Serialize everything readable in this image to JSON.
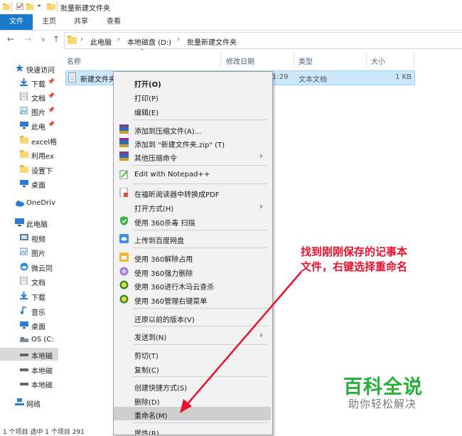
{
  "window": {
    "title": "批量新建文件夹"
  },
  "ribbon": {
    "tabs": [
      "文件",
      "主页",
      "共享",
      "查看"
    ]
  },
  "address": {
    "crumbs": [
      "此电脑",
      "本地磁盘 (D:)",
      "批量新建文件夹"
    ]
  },
  "columns": {
    "name": "名称",
    "modified": "修改日期",
    "type": "类型",
    "size": "大小"
  },
  "file": {
    "name": "新建文件夹",
    "time": "1:29",
    "type": "文本文档",
    "size": "1 KB"
  },
  "nav": {
    "items": [
      {
        "label": "快速访问",
        "icon": "star-icon"
      },
      {
        "label": "下载",
        "icon": "download-icon"
      },
      {
        "label": "文档",
        "icon": "document-icon"
      },
      {
        "label": "图片",
        "icon": "picture-icon"
      },
      {
        "label": "此电",
        "icon": "desktop-icon"
      },
      {
        "label": "excel格",
        "icon": "folder-icon"
      },
      {
        "label": "利用ex",
        "icon": "folder-icon"
      },
      {
        "label": "设置下",
        "icon": "folder-icon"
      },
      {
        "label": "桌面",
        "icon": "desktop-icon"
      },
      {
        "label": "OneDriv",
        "icon": "cloud-icon"
      },
      {
        "label": "此电脑",
        "icon": "computer-icon"
      },
      {
        "label": "视频",
        "icon": "video-icon"
      },
      {
        "label": "图片",
        "icon": "picture-icon"
      },
      {
        "label": "微云同",
        "icon": "weiyun-icon"
      },
      {
        "label": "文档",
        "icon": "document-icon"
      },
      {
        "label": "下载",
        "icon": "download-icon"
      },
      {
        "label": "音乐",
        "icon": "music-icon"
      },
      {
        "label": "桌面",
        "icon": "desktop-icon"
      },
      {
        "label": "OS (C:",
        "icon": "drive-icon"
      },
      {
        "label": "本地磁",
        "icon": "drive-icon"
      },
      {
        "label": "本地磁",
        "icon": "drive-icon"
      },
      {
        "label": "本地磁",
        "icon": "drive-icon"
      },
      {
        "label": "网络",
        "icon": "network-icon"
      }
    ]
  },
  "status": {
    "text": "1 个项目    选中 1 个项目  291"
  },
  "menu": {
    "open": "打开(O)",
    "print": "打印(P)",
    "edit": "编辑(E)",
    "add_archive": "添加到压缩文件(A)...",
    "add_zip": "添加到 \"新建文件夹.zip\" (T)",
    "other_zip": "其他压缩命令",
    "notepad": "Edit with Notepad++",
    "pdf": "在福昕阅读器中转换成PDF",
    "open_with": "打开方式(H)",
    "scan360": "使用 360杀毒 扫描",
    "baidu": "上传到百度网盘",
    "unlock360": "使用 360解除占用",
    "delete360": "使用 360强力删除",
    "trojan360": "使用 360进行木马云查杀",
    "manage360": "使用 360管理右键菜单",
    "restore": "还原以前的版本(V)",
    "sendto": "发送到(N)",
    "cut": "剪切(T)",
    "copy": "复制(C)",
    "shortcut": "创建快捷方式(S)",
    "delete": "删除(D)",
    "rename": "重命名(M)",
    "properties": "属性(R)"
  },
  "annotation": {
    "line1": "找到刚刚保存的记事本",
    "line2": "文件，右键选择重命名"
  },
  "watermark": {
    "main": "百科全说",
    "sub": "助你轻松解决"
  },
  "colors": {
    "accent": "#1979ca",
    "annotation": "#e8122f",
    "watermark": "#27b03a"
  }
}
